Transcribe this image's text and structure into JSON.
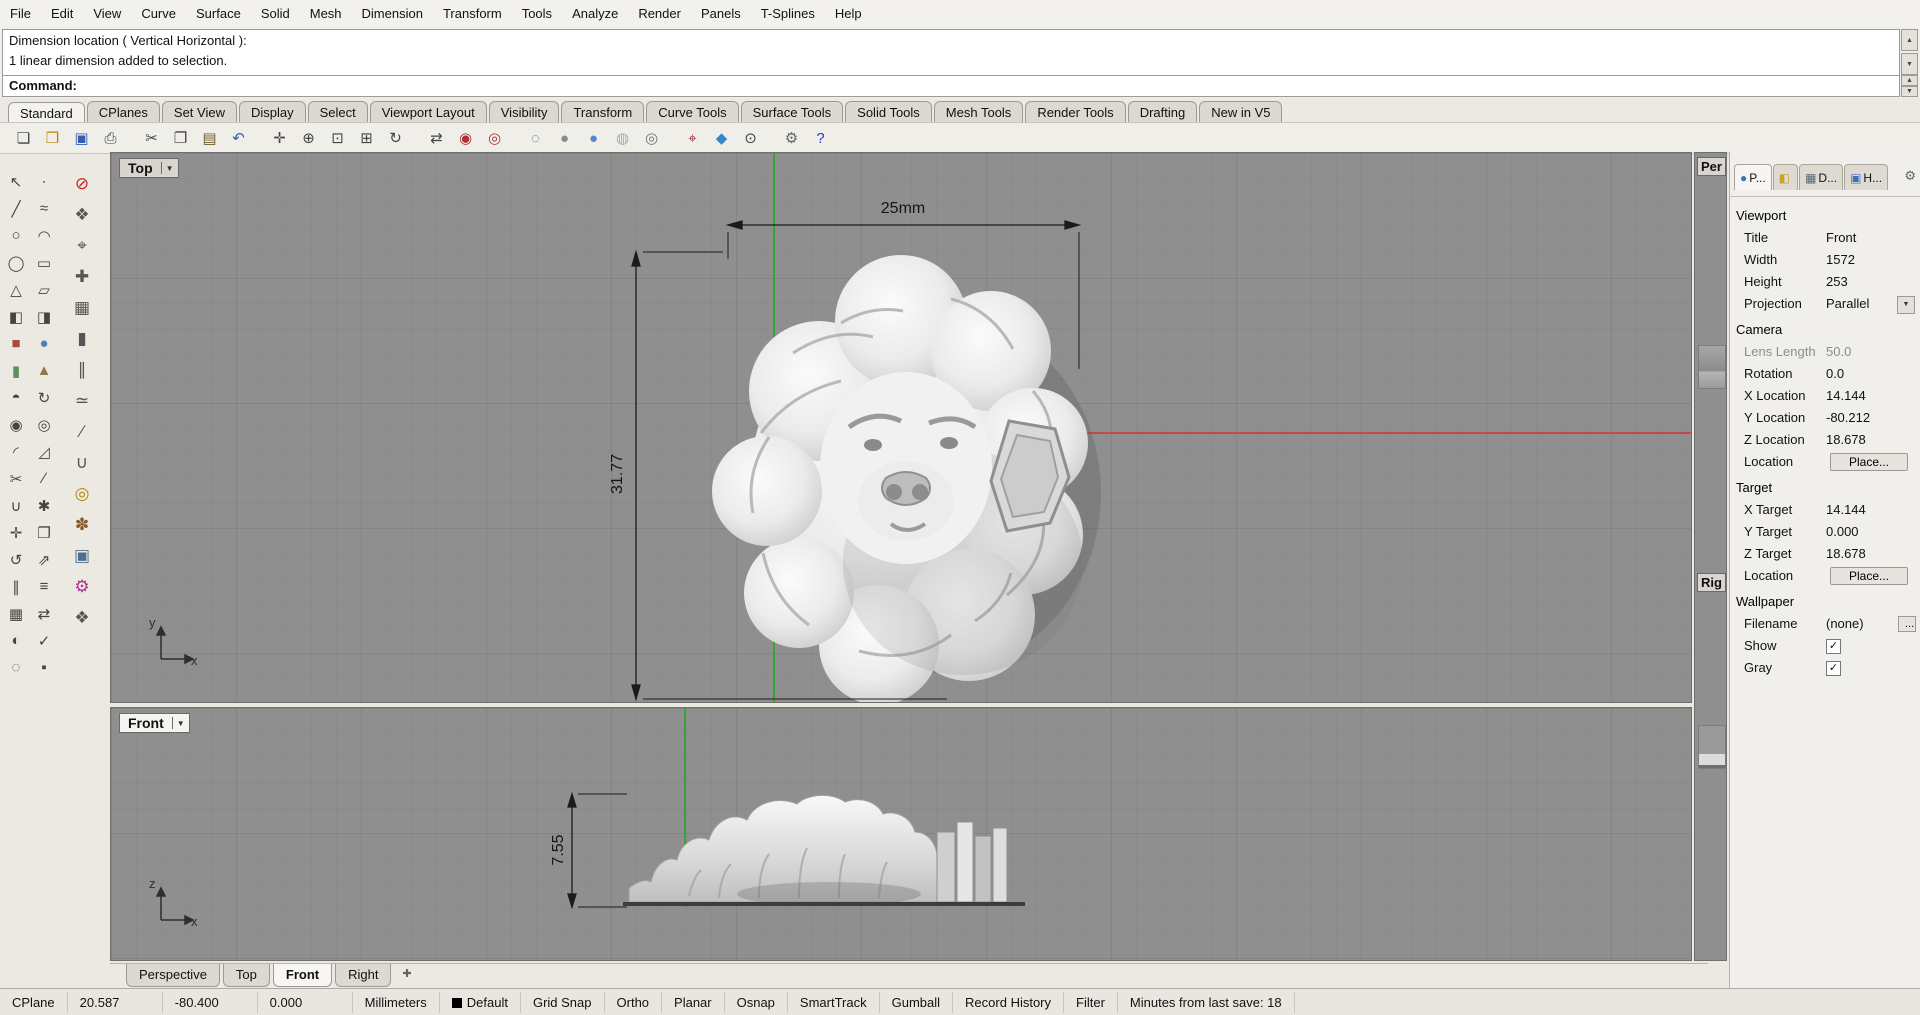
{
  "menu": {
    "items": [
      "File",
      "Edit",
      "View",
      "Curve",
      "Surface",
      "Solid",
      "Mesh",
      "Dimension",
      "Transform",
      "Tools",
      "Analyze",
      "Render",
      "Panels",
      "T-Splines",
      "Help"
    ]
  },
  "command": {
    "history": [
      "Dimension location ( Vertical  Horizontal ):",
      "1 linear dimension added to selection."
    ],
    "prompt": "Command:"
  },
  "icons": {
    "up": "▲",
    "down": "▼",
    "combo": "▼",
    "plus": "✚",
    "gear": "⚙",
    "check": "✓"
  },
  "toolbar_tabs": {
    "active": "Standard",
    "items": [
      "Standard",
      "CPlanes",
      "Set View",
      "Display",
      "Select",
      "Viewport Layout",
      "Visibility",
      "Transform",
      "Curve Tools",
      "Surface Tools",
      "Solid Tools",
      "Mesh Tools",
      "Render Tools",
      "Drafting",
      "New in V5"
    ]
  },
  "toolbar_icons": [
    {
      "name": "new-file",
      "glyph": "❏",
      "color": "#444"
    },
    {
      "name": "open-file",
      "glyph": "❒",
      "color": "#b8860b"
    },
    {
      "name": "save",
      "glyph": "▣",
      "color": "#2f5fae"
    },
    {
      "name": "print",
      "glyph": "⎙",
      "color": "#444"
    },
    {
      "name": "cut",
      "glyph": "✂",
      "color": "#444",
      "gap": true
    },
    {
      "name": "copy",
      "glyph": "❐",
      "color": "#444"
    },
    {
      "name": "paste",
      "glyph": "▤",
      "color": "#6b5b2a"
    },
    {
      "name": "undo",
      "glyph": "↶",
      "color": "#2f5fae"
    },
    {
      "name": "pan",
      "glyph": "✛",
      "color": "#444",
      "gap": true
    },
    {
      "name": "zoom-dynamic",
      "glyph": "⊕",
      "color": "#444"
    },
    {
      "name": "zoom-window",
      "glyph": "⊡",
      "color": "#444"
    },
    {
      "name": "zoom-extents",
      "glyph": "⊞",
      "color": "#444"
    },
    {
      "name": "rotate-view",
      "glyph": "↻",
      "color": "#444"
    },
    {
      "name": "move",
      "glyph": "⇄",
      "color": "#444",
      "gap": true
    },
    {
      "name": "render",
      "glyph": "◉",
      "color": "#b03030"
    },
    {
      "name": "render-preview",
      "glyph": "◎",
      "color": "#b03030"
    },
    {
      "name": "wireframe-display",
      "glyph": "◌",
      "color": "#555",
      "gap": true
    },
    {
      "name": "shaded-display",
      "glyph": "●",
      "color": "#8a8a8a"
    },
    {
      "name": "rendered-display",
      "glyph": "●",
      "color": "#5588cc"
    },
    {
      "name": "ghosted-display",
      "glyph": "◍",
      "color": "#99aabb"
    },
    {
      "name": "xray-display",
      "glyph": "◎",
      "color": "#667788"
    },
    {
      "name": "object-snap",
      "glyph": "⌖",
      "color": "#a03030",
      "gap": true
    },
    {
      "name": "gumball",
      "glyph": "◆",
      "color": "#3388cc"
    },
    {
      "name": "record-history",
      "glyph": "⊙",
      "color": "#444"
    },
    {
      "name": "options-gear",
      "glyph": "⚙",
      "color": "#666",
      "gap": true
    },
    {
      "name": "help",
      "glyph": "?",
      "color": "#2244bb"
    }
  ],
  "left_toolbar": [
    {
      "name": "select",
      "glyph": "↖"
    },
    {
      "name": "single-point",
      "glyph": "∙"
    },
    {
      "name": "polyline",
      "glyph": "╱"
    },
    {
      "name": "control-point-curve",
      "glyph": "≈"
    },
    {
      "name": "circle",
      "glyph": "○"
    },
    {
      "name": "arc",
      "glyph": "◠"
    },
    {
      "name": "ellipse",
      "glyph": "◯"
    },
    {
      "name": "rectangle",
      "glyph": "▭"
    },
    {
      "name": "polygon",
      "glyph": "△"
    },
    {
      "name": "plane",
      "glyph": "▱"
    },
    {
      "name": "surface-loft",
      "glyph": "◧"
    },
    {
      "name": "surface-sweep",
      "glyph": "◨"
    },
    {
      "name": "box",
      "glyph": "■",
      "color": "#a84c3f"
    },
    {
      "name": "sphere",
      "glyph": "●",
      "color": "#4f7fb5"
    },
    {
      "name": "cylinder",
      "glyph": "▮",
      "color": "#5f8f5f"
    },
    {
      "name": "cone",
      "glyph": "▲",
      "color": "#8a7a4a"
    },
    {
      "name": "extrude",
      "glyph": "◓"
    },
    {
      "name": "revolve",
      "glyph": "↻"
    },
    {
      "name": "boolean-union",
      "glyph": "◉"
    },
    {
      "name": "boolean-difference",
      "glyph": "◎"
    },
    {
      "name": "fillet",
      "glyph": "◜"
    },
    {
      "name": "chamfer",
      "glyph": "◿"
    },
    {
      "name": "trim",
      "glyph": "✂"
    },
    {
      "name": "split",
      "glyph": "∕"
    },
    {
      "name": "join",
      "glyph": "∪"
    },
    {
      "name": "explode",
      "glyph": "✱"
    },
    {
      "name": "move-object",
      "glyph": "✛"
    },
    {
      "name": "copy-object",
      "glyph": "❐"
    },
    {
      "name": "rotate-object",
      "glyph": "↺"
    },
    {
      "name": "scale-object",
      "glyph": "⇗"
    },
    {
      "name": "mirror",
      "glyph": "∥"
    },
    {
      "name": "offset",
      "glyph": "≡"
    },
    {
      "name": "array",
      "glyph": "▦"
    },
    {
      "name": "orient",
      "glyph": "⇄"
    },
    {
      "name": "curve-boolean",
      "glyph": "◐"
    },
    {
      "name": "analyze-direction",
      "glyph": "✓"
    },
    {
      "name": "hide-object",
      "glyph": "◌"
    },
    {
      "name": "lock-object",
      "glyph": "▪"
    }
  ],
  "secondary_toolbar": [
    {
      "name": "tsplines-stop",
      "glyph": "⊘",
      "color": "#cc2222"
    },
    {
      "name": "tsplines-box",
      "glyph": "❖",
      "color": "#555"
    },
    {
      "name": "axis-gizmo",
      "glyph": "⌖",
      "color": "#555"
    },
    {
      "name": "manipulator",
      "glyph": "✚",
      "color": "#555"
    },
    {
      "name": "cage-edit",
      "glyph": "▦",
      "color": "#555"
    },
    {
      "name": "pipe",
      "glyph": "▮",
      "color": "#555"
    },
    {
      "name": "symmetry",
      "glyph": "∥",
      "color": "#555"
    },
    {
      "name": "match-surface",
      "glyph": "≃",
      "color": "#555"
    },
    {
      "name": "insert-edge",
      "glyph": "∕",
      "color": "#555"
    },
    {
      "name": "weld-points",
      "glyph": "∪",
      "color": "#555"
    },
    {
      "name": "zoom-lens",
      "glyph": "◎",
      "color": "#b8860b"
    },
    {
      "name": "paw-select",
      "glyph": "✽",
      "color": "#8a5a2a"
    },
    {
      "name": "snapshot",
      "glyph": "▣",
      "color": "#4f6f8f"
    },
    {
      "name": "settings-gear",
      "glyph": "⚙",
      "color": "#b03090"
    },
    {
      "name": "edge-tools",
      "glyph": "❖",
      "color": "#555"
    }
  ],
  "viewport_top": {
    "label": "Top",
    "dim_width": "25mm",
    "dim_height": "31.77",
    "axis_h": "x",
    "axis_v": "y"
  },
  "viewport_front": {
    "label": "Front",
    "dim_height": "7.55",
    "axis_h": "x",
    "axis_v": "z"
  },
  "collapsed": {
    "perspective_label": "Per",
    "right_label": "Rig"
  },
  "viewport_tabs": {
    "active": "Front",
    "items": [
      "Perspective",
      "Top",
      "Front",
      "Right"
    ]
  },
  "properties": {
    "tabs": [
      {
        "name": "properties",
        "label": "P...",
        "glyph": "●",
        "color": "#3f6fbf",
        "active": true
      },
      {
        "name": "layers",
        "label": "",
        "glyph": "◧",
        "color": "#c9a227",
        "active": false
      },
      {
        "name": "display",
        "label": "D...",
        "glyph": "▦",
        "color": "#556677",
        "active": false
      },
      {
        "name": "help",
        "label": "H...",
        "glyph": "▣",
        "color": "#3f6fbf",
        "active": false
      }
    ],
    "sections": [
      {
        "header": "Viewport",
        "rows": [
          {
            "label": "Title",
            "value": "Front",
            "type": "text"
          },
          {
            "label": "Width",
            "value": "1572",
            "type": "text"
          },
          {
            "label": "Height",
            "value": "253",
            "type": "text"
          },
          {
            "label": "Projection",
            "value": "Parallel",
            "type": "dropdown"
          }
        ]
      },
      {
        "header": "Camera",
        "rows": [
          {
            "label": "Lens Length",
            "value": "50.0",
            "type": "text",
            "disabled": true
          },
          {
            "label": "Rotation",
            "value": "0.0",
            "type": "text"
          },
          {
            "label": "X Location",
            "value": "14.144",
            "type": "text"
          },
          {
            "label": "Y Location",
            "value": "-80.212",
            "type": "text"
          },
          {
            "label": "Z Location",
            "value": "18.678",
            "type": "text"
          },
          {
            "label": "Location",
            "value": "Place...",
            "type": "button"
          }
        ]
      },
      {
        "header": "Target",
        "rows": [
          {
            "label": "X Target",
            "value": "14.144",
            "type": "text"
          },
          {
            "label": "Y Target",
            "value": "0.000",
            "type": "text"
          },
          {
            "label": "Z Target",
            "value": "18.678",
            "type": "text"
          },
          {
            "label": "Location",
            "value": "Place...",
            "type": "button"
          }
        ]
      },
      {
        "header": "Wallpaper",
        "rows": [
          {
            "label": "Filename",
            "value": "(none)",
            "type": "file",
            "button": "..."
          },
          {
            "label": "Show",
            "type": "checkbox",
            "checked": true
          },
          {
            "label": "Gray",
            "type": "checkbox",
            "checked": true
          }
        ]
      }
    ]
  },
  "status_bar": {
    "cplane_label": "CPlane",
    "x": "20.587",
    "y": "-80.400",
    "z": "0.000",
    "units": "Millimeters",
    "layer": "Default",
    "toggles": [
      "Grid Snap",
      "Ortho",
      "Planar",
      "Osnap",
      "SmartTrack",
      "Gumball",
      "Record History",
      "Filter"
    ],
    "message": "Minutes from last save: 18"
  }
}
